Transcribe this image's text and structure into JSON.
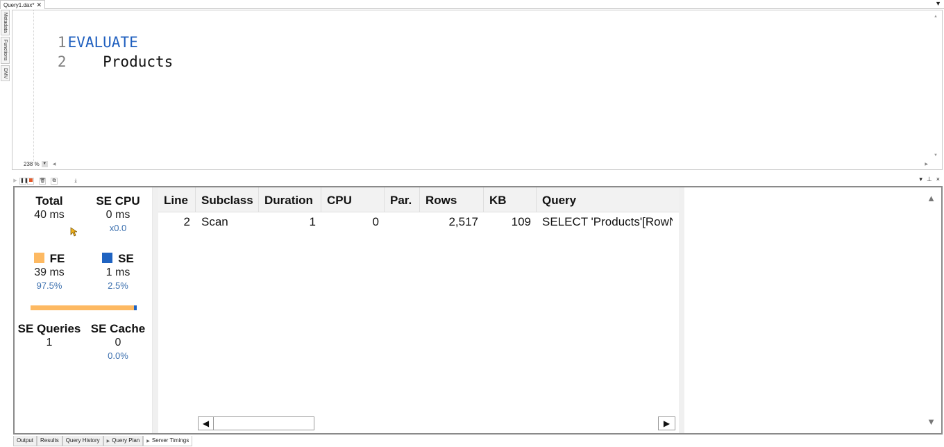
{
  "document": {
    "tab_label": "Query1.dax*",
    "close_icon": "close-icon",
    "menu_icon": "dropdown-icon"
  },
  "side_tabs": [
    "Metadata",
    "Functions",
    "DMV"
  ],
  "editor": {
    "lines": [
      {
        "number": "1",
        "keyword": "EVALUATE",
        "text": ""
      },
      {
        "number": "2",
        "keyword": "",
        "text": "    Products"
      }
    ],
    "zoom_level": "238 %"
  },
  "toolbar": {
    "buttons": [
      "play-icon",
      "pause-icon",
      "stop-icon",
      "delete-icon",
      "copy-icon",
      "export-icon"
    ],
    "panel_controls": {
      "dropdown": "▾",
      "pin": "⊥",
      "close": "×"
    }
  },
  "server_timings": {
    "total": {
      "label": "Total",
      "value": "40 ms"
    },
    "se_cpu": {
      "label": "SE CPU",
      "value": "0 ms",
      "ratio": "x0.0"
    },
    "fe": {
      "label": "FE",
      "value": "39 ms",
      "percent": "97.5%",
      "color": "#fdb962"
    },
    "se": {
      "label": "SE",
      "value": "1 ms",
      "percent": "2.5%",
      "color": "#1f63c1"
    },
    "fe_se_split": {
      "fe_fraction": 0.975,
      "se_fraction": 0.025
    },
    "se_queries": {
      "label": "SE Queries",
      "value": "1"
    },
    "se_cache": {
      "label": "SE Cache",
      "value": "0",
      "percent": "0.0%"
    }
  },
  "grid": {
    "columns": [
      "Line",
      "Subclass",
      "Duration",
      "CPU",
      "Par.",
      "Rows",
      "KB",
      "Query"
    ],
    "rows": [
      {
        "line": "2",
        "subclass": "Scan",
        "duration": "1",
        "cpu": "0",
        "par": "",
        "rows": "2,517",
        "kb": "109",
        "query": "SELECT 'Products'[RowN"
      }
    ]
  },
  "bottom_tabs": [
    {
      "label": "Output",
      "has_arrow": false,
      "active": false
    },
    {
      "label": "Results",
      "has_arrow": false,
      "active": false
    },
    {
      "label": "Query History",
      "has_arrow": false,
      "active": false
    },
    {
      "label": "Query Plan",
      "has_arrow": true,
      "active": false
    },
    {
      "label": "Server Timings",
      "has_arrow": true,
      "active": true
    }
  ]
}
